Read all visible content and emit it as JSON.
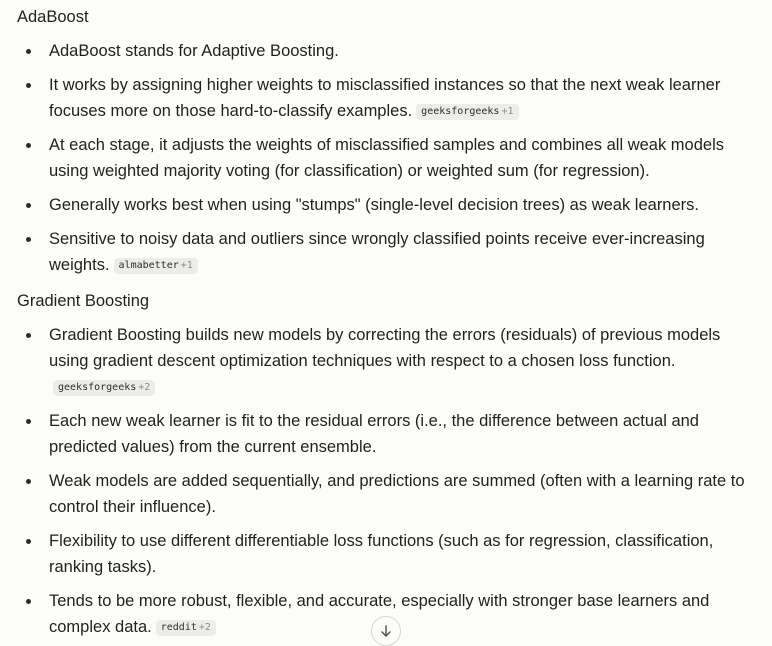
{
  "sections": [
    {
      "title": "AdaBoost",
      "items": [
        {
          "text": "AdaBoost stands for Adaptive Boosting."
        },
        {
          "text": "It works by assigning higher weights to misclassified instances so that the next weak learner focuses more on those hard-to-classify examples.",
          "citation": {
            "source": "geeksforgeeks",
            "count": "+1"
          }
        },
        {
          "text": "At each stage, it adjusts the weights of misclassified samples and combines all weak models using weighted majority voting (for classification) or weighted sum (for regression)."
        },
        {
          "text": "Generally works best when using \"stumps\" (single-level decision trees) as weak learners."
        },
        {
          "text": "Sensitive to noisy data and outliers since wrongly classified points receive ever-increasing weights.",
          "citation": {
            "source": "almabetter",
            "count": "+1"
          }
        }
      ]
    },
    {
      "title": "Gradient Boosting",
      "items": [
        {
          "text": "Gradient Boosting builds new models by correcting the errors (residuals) of previous models using gradient descent optimization techniques with respect to a chosen loss function.",
          "citation": {
            "source": "geeksforgeeks",
            "count": "+2"
          }
        },
        {
          "text": "Each new weak learner is fit to the residual errors (i.e., the difference between actual and predicted values) from the current ensemble."
        },
        {
          "text": "Weak models are added sequentially, and predictions are summed (often with a learning rate to control their influence)."
        },
        {
          "text": "Flexibility to use different differentiable loss functions (such as for regression, classification, ranking tasks)."
        },
        {
          "text": "Tends to be more robust, flexible, and accurate, especially with stronger base learners and complex data.",
          "citation": {
            "source": "reddit",
            "count": "+2"
          }
        }
      ]
    }
  ],
  "scroll_button": {
    "icon": "arrow-down-icon"
  }
}
